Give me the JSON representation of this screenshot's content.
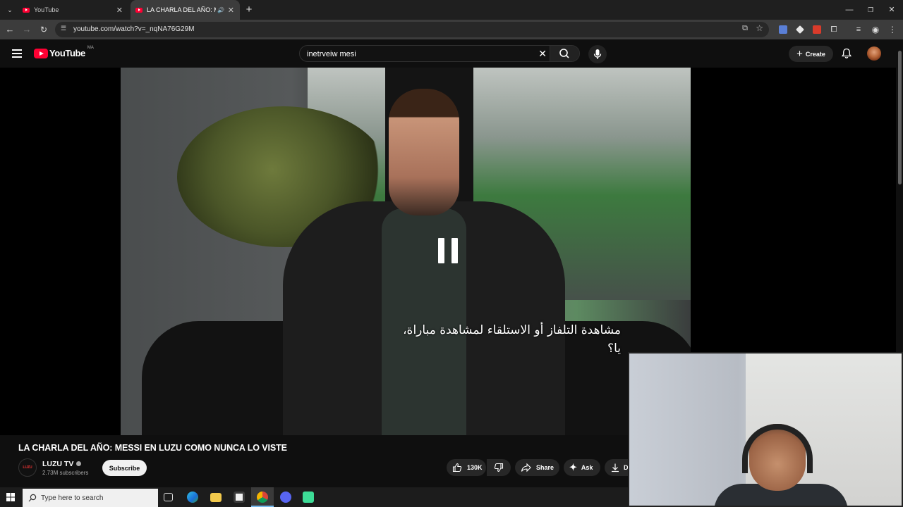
{
  "browser": {
    "tabs": [
      {
        "label": "YouTube"
      },
      {
        "label": "LA CHARLA DEL AÑO: MESSI EN LUZU COMO NUNCA LO VISTE"
      }
    ],
    "url": "youtube.com/watch?v=_nqNA76G29M"
  },
  "youtube": {
    "logo_text": "YouTube",
    "region": "MA",
    "search_query": "inetrveiw mesi",
    "create_label": "Create"
  },
  "video": {
    "subtitle_lines": [
      "مشاهدة التلفاز أو الاستلقاء لمشاهدة مباراة،",
      "يا؟"
    ],
    "title": "LA CHARLA DEL AÑO: MESSI EN LUZU COMO NUNCA LO VISTE",
    "channel": {
      "name": "LUZU TV",
      "subscribers": "2.73M subscribers",
      "avatar_text": "LUZU"
    },
    "subscribe_label": "Subscribe",
    "likes": "130K",
    "share_label": "Share",
    "ask_label": "Ask",
    "download_label": "Do"
  },
  "taskbar": {
    "search_placeholder": "Type here to search"
  },
  "colors": {
    "youtube_red": "#ff0033",
    "background": "#0f0f0f"
  }
}
